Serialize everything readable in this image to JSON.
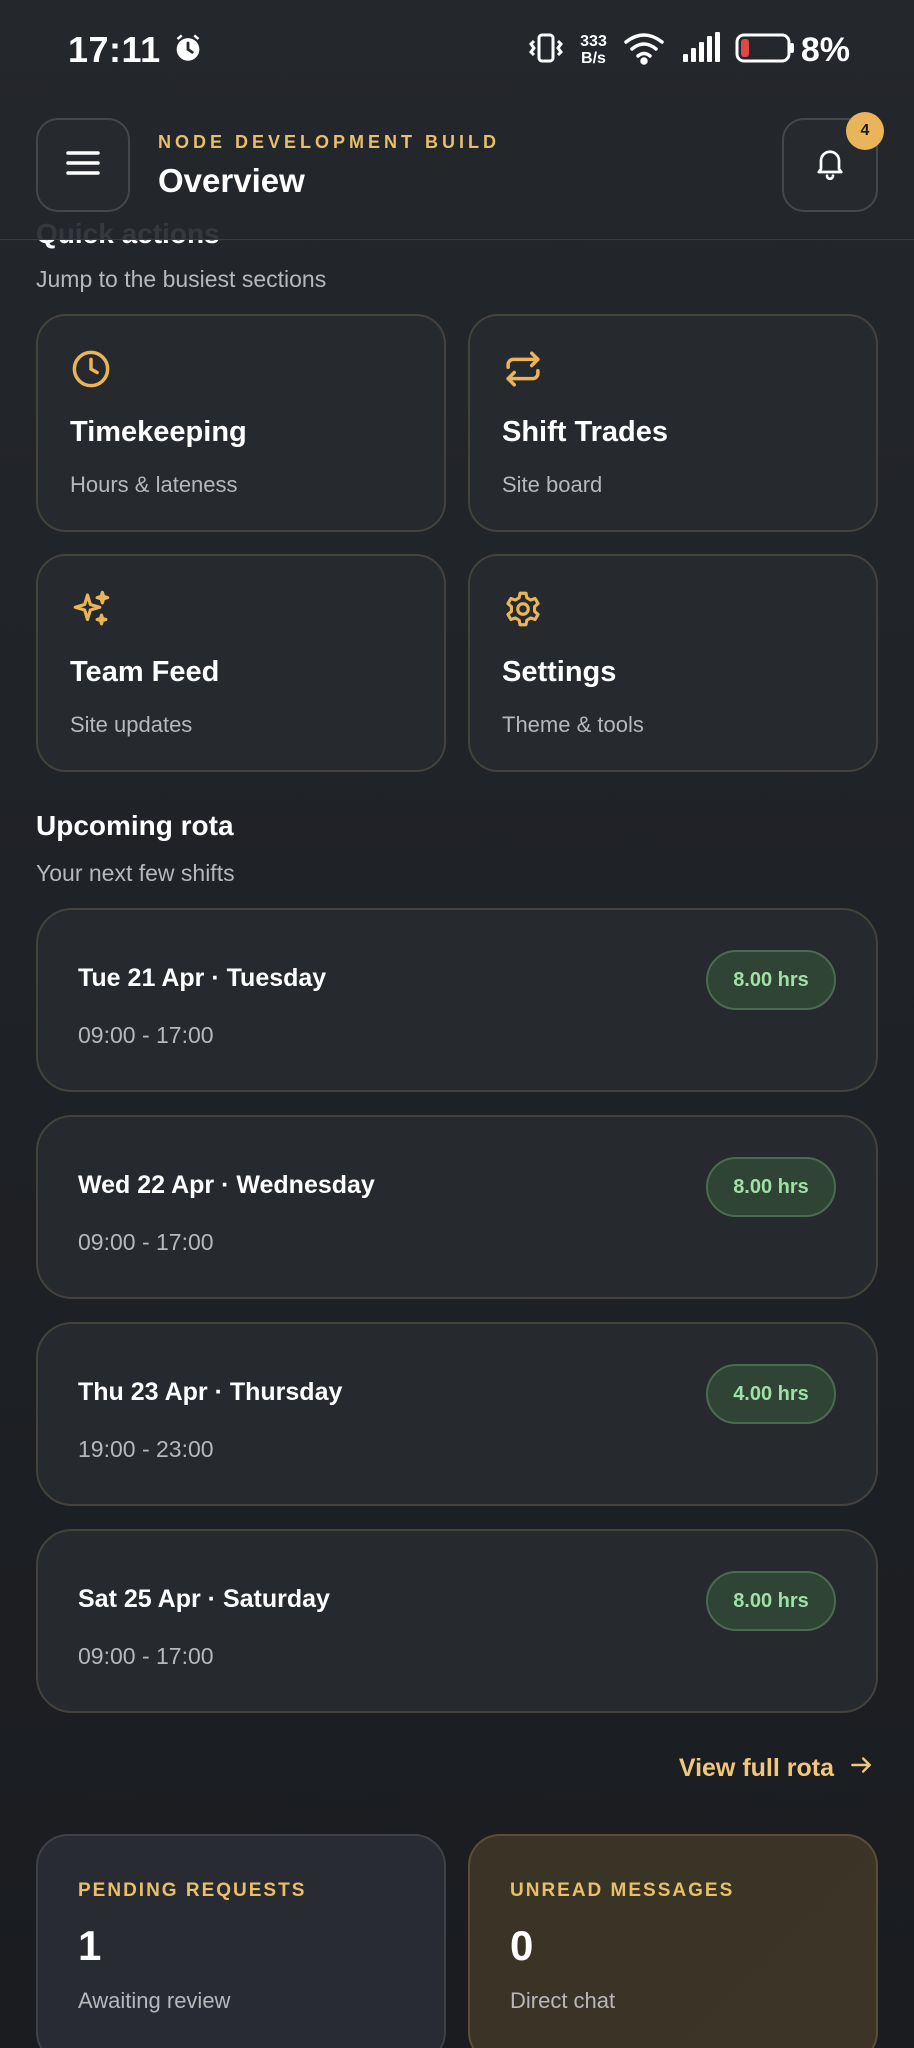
{
  "status_bar": {
    "time": "17:11",
    "net_speed_value": "333",
    "net_speed_unit": "B/s",
    "battery": "8%"
  },
  "header": {
    "eyebrow": "NODE DEVELOPMENT BUILD",
    "title": "Overview",
    "notification_count": "4"
  },
  "quick_actions": {
    "heading": "Quick actions",
    "subtitle": "Jump to the busiest sections",
    "items": [
      {
        "title": "Timekeeping",
        "subtitle": "Hours & lateness",
        "icon": "clock-icon"
      },
      {
        "title": "Shift Trades",
        "subtitle": "Site board",
        "icon": "swap-icon"
      },
      {
        "title": "Team Feed",
        "subtitle": "Site updates",
        "icon": "sparkles-icon"
      },
      {
        "title": "Settings",
        "subtitle": "Theme & tools",
        "icon": "gear-icon"
      }
    ]
  },
  "rota": {
    "heading": "Upcoming rota",
    "subtitle": "Your next few shifts",
    "shifts": [
      {
        "date": "Tue 21 Apr · Tuesday",
        "time": "09:00 - 17:00",
        "hours": "8.00 hrs"
      },
      {
        "date": "Wed 22 Apr · Wednesday",
        "time": "09:00 - 17:00",
        "hours": "8.00 hrs"
      },
      {
        "date": "Thu 23 Apr · Thursday",
        "time": "19:00 - 23:00",
        "hours": "4.00 hrs"
      },
      {
        "date": "Sat 25 Apr · Saturday",
        "time": "09:00 - 17:00",
        "hours": "8.00 hrs"
      }
    ],
    "view_full": "View full rota"
  },
  "stats": [
    {
      "label": "PENDING REQUESTS",
      "value": "1",
      "subtitle": "Awaiting review"
    },
    {
      "label": "UNREAD MESSAGES",
      "value": "0",
      "subtitle": "Direct chat"
    }
  ],
  "colors": {
    "accent": "#e9bf6a",
    "hours_pill_text": "#9fe0a6",
    "background": "#1f2226"
  }
}
